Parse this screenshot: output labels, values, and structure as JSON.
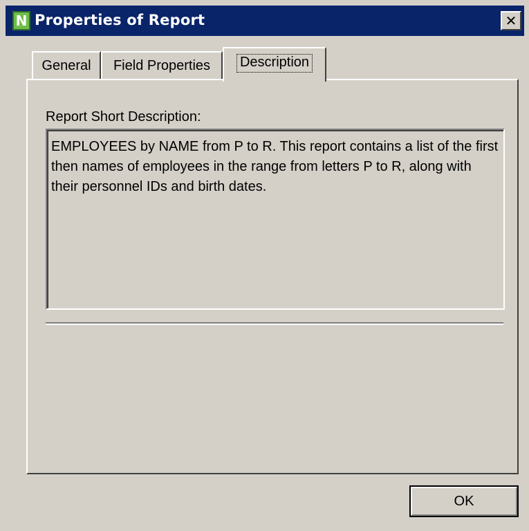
{
  "window": {
    "title": "Properties of Report",
    "icon_letter": "N",
    "close_glyph": "✕"
  },
  "tabs": [
    {
      "label": "General",
      "selected": false
    },
    {
      "label": "Field Properties",
      "selected": false
    },
    {
      "label": "Description",
      "selected": true
    }
  ],
  "description": {
    "label": "Report Short Description:",
    "text": "EMPLOYEES by NAME from P to R. This report contains a list of the first then names of employees in the range from letters P to R, along with their personnel IDs and birth dates."
  },
  "buttons": {
    "ok_label": "OK"
  },
  "colors": {
    "titlebar": "#0a246a",
    "window_background": "#d4d0c8",
    "icon_green": "#6fbf4a"
  }
}
